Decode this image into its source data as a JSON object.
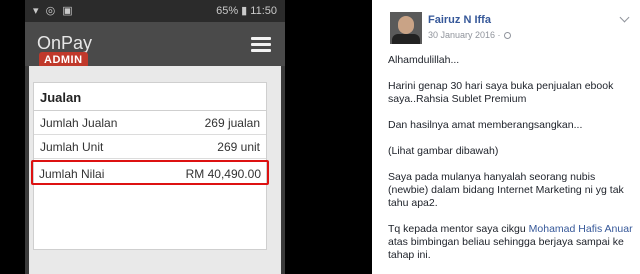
{
  "phone": {
    "status_left": "▾ ◎ ▣",
    "status_right": "65% ▮ 11:50",
    "app_title": "OnPay",
    "admin_badge": "ADMIN",
    "card": {
      "heading": "Jualan",
      "rows": [
        {
          "label": "Jumlah Jualan",
          "value": "269 jualan"
        },
        {
          "label": "Jumlah Unit",
          "value": "269 unit"
        },
        {
          "label": "Jumlah Nilai",
          "value": "RM 40,490.00"
        }
      ]
    }
  },
  "post": {
    "author": "Fairuz N Iffa",
    "date": "30 January 2016 ·",
    "paragraphs": [
      "Alhamdulillah...",
      "Harini genap 30 hari saya buka penjualan ebook saya..Rahsia Sublet Premium",
      "Dan hasilnya amat memberangsangkan...",
      "(Lihat gambar dibawah)",
      "Saya pada mulanya hanyalah seorang nubis (newbie) dalam bidang Internet Marketing ni yg tak tahu apa2."
    ],
    "last_prefix": "Tq kepada mentor saya cikgu ",
    "mention": "Mohamad Hafis Anuar",
    "last_suffix": "atas bimbingan beliau sehingga berjaya sampai ke tahap ini."
  }
}
